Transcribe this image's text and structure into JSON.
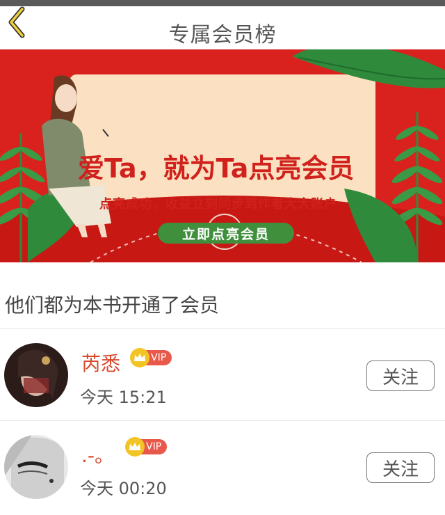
{
  "header": {
    "title": "专属会员榜"
  },
  "banner": {
    "headline": "爱Ta，就为Ta点亮会员",
    "subtitle": "点亮成功，收益立刻同步到作者大大账户",
    "cta": "立即点亮会员"
  },
  "section": {
    "title": "他们都为本书开通了会员"
  },
  "members": [
    {
      "name": "芮悉",
      "badge": "VIP",
      "time": "今天 15:21",
      "follow": "关注"
    },
    {
      "name": ".-。",
      "badge": "VIP",
      "time": "今天 00:20",
      "follow": "关注"
    }
  ],
  "colors": {
    "accent": "#d9221d",
    "name": "#d8492b",
    "vip": "#e9594b",
    "cta": "#3f8f3c"
  }
}
